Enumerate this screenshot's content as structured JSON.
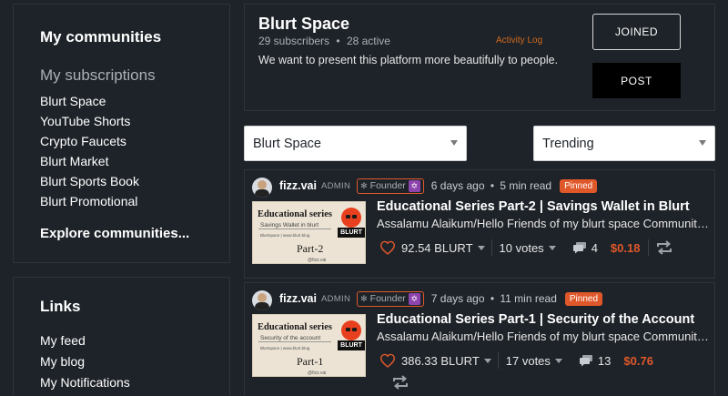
{
  "sidebar": {
    "title": "My communities",
    "subscriptions_title": "My subscriptions",
    "subscriptions": [
      "Blurt Space",
      "YouTube Shorts",
      "Crypto Faucets",
      "Blurt Market",
      "Blurt Sports Book",
      "Blurt Promotional"
    ],
    "explore": "Explore communities..."
  },
  "links": {
    "title": "Links",
    "items": [
      "My feed",
      "My blog",
      "My Notifications"
    ]
  },
  "community": {
    "name": "Blurt Space",
    "subscribers": "29 subscribers",
    "dot": "•",
    "active": "28 active",
    "activity_log": "Activity Log",
    "description": "We want to present this platform more beautifully to people.",
    "joined_label": "JOINED",
    "post_label": "POST"
  },
  "filters": {
    "community_value": "Blurt Space",
    "sort_value": "Trending"
  },
  "posts": [
    {
      "author": "fizz.vai",
      "role": "ADMIN",
      "founder": "Founder",
      "time": "6 days ago",
      "dot": "•",
      "read": "5 min read",
      "pinned": "Pinned",
      "thumb_title": "Educational series",
      "thumb_sub": "Savings Wallet in blurt",
      "thumb_small": "Blurtspace  |  www.blurt.blog",
      "thumb_part": "Part-2",
      "thumb_handle": "@fizz.vai",
      "thumb_brand": "BLURT",
      "title": "Educational Series Part-2 | Savings Wallet in Blurt",
      "excerpt": "Assalamu Alaikum/Hello Friends of my blurt space Community...",
      "payout": "92.54 BLURT",
      "votes": "10 votes",
      "comments": "4",
      "amount": "$0.18"
    },
    {
      "author": "fizz.vai",
      "role": "ADMIN",
      "founder": "Founder",
      "time": "7 days ago",
      "dot": "•",
      "read": "11 min read",
      "pinned": "Pinned",
      "thumb_title": "Educational series",
      "thumb_sub": "Security of the account",
      "thumb_small": "Blurtspace  |  www.blurt.blog",
      "thumb_part": "Part-1",
      "thumb_handle": "@fizz.vai",
      "thumb_brand": "BLURT",
      "title": "Educational Series Part-1 | Security of the Account",
      "excerpt": "Assalamu Alaikum/Hello Friends of my blurt space Community...",
      "payout": "386.33 BLURT",
      "votes": "17 votes",
      "comments": "13",
      "amount": "$0.76"
    }
  ],
  "colors": {
    "accent": "#e0582a",
    "background": "#1e2329",
    "border": "#2d343c"
  },
  "icons": [
    "heart-icon",
    "comment-icon",
    "reblog-icon",
    "chevron-down-icon",
    "star-icon"
  ]
}
